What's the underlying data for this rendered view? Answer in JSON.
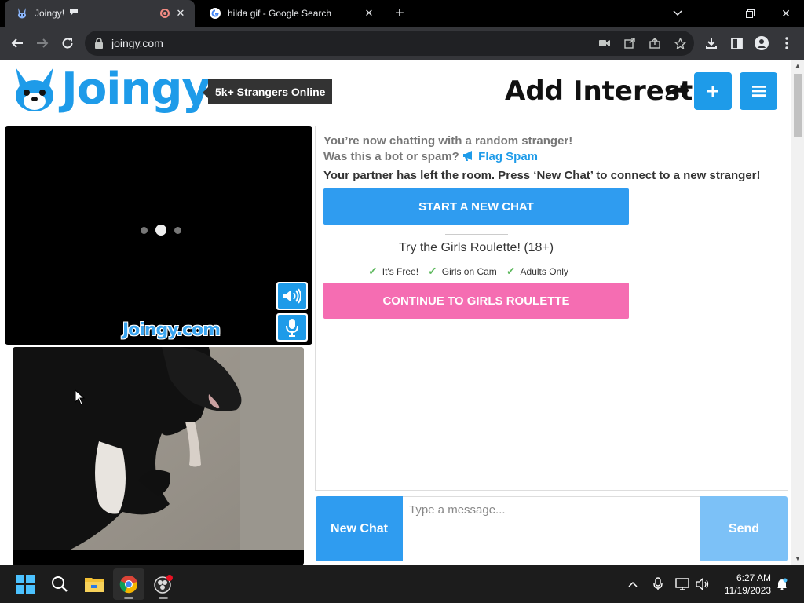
{
  "browser": {
    "tabs": [
      {
        "title": "Joingy!",
        "active": true
      },
      {
        "title": "hilda gif - Google Search",
        "active": false
      }
    ],
    "url": "joingy.com"
  },
  "site": {
    "logo_text": "Joingy",
    "online_badge": "5k+ Strangers Online",
    "add_interests": "Add Interests",
    "plus_label": "+",
    "video_watermark": "Joingy.com"
  },
  "chat": {
    "status_line": "You’re now chatting with a random stranger!",
    "bot_question": "Was this a bot or spam?",
    "flag_label": "Flag Spam",
    "partner_left": "Your partner has left the room. Press ‘New Chat’ to connect to a new stranger!",
    "start_new_label": "START A NEW CHAT",
    "roulette_title": "Try the Girls Roulette! (18+)",
    "features": [
      "It's Free!",
      "Girls on Cam",
      "Adults Only"
    ],
    "continue_label": "CONTINUE TO GIRLS ROULETTE"
  },
  "composer": {
    "new_chat_label": "New Chat",
    "placeholder": "Type a message...",
    "send_label": "Send"
  },
  "taskbar": {
    "time": "6:27 AM",
    "date": "11/19/2023"
  },
  "colors": {
    "brand_blue": "#1e9be9",
    "roulette_pink": "#f56db2",
    "send_disabled": "#7cc1f7"
  }
}
